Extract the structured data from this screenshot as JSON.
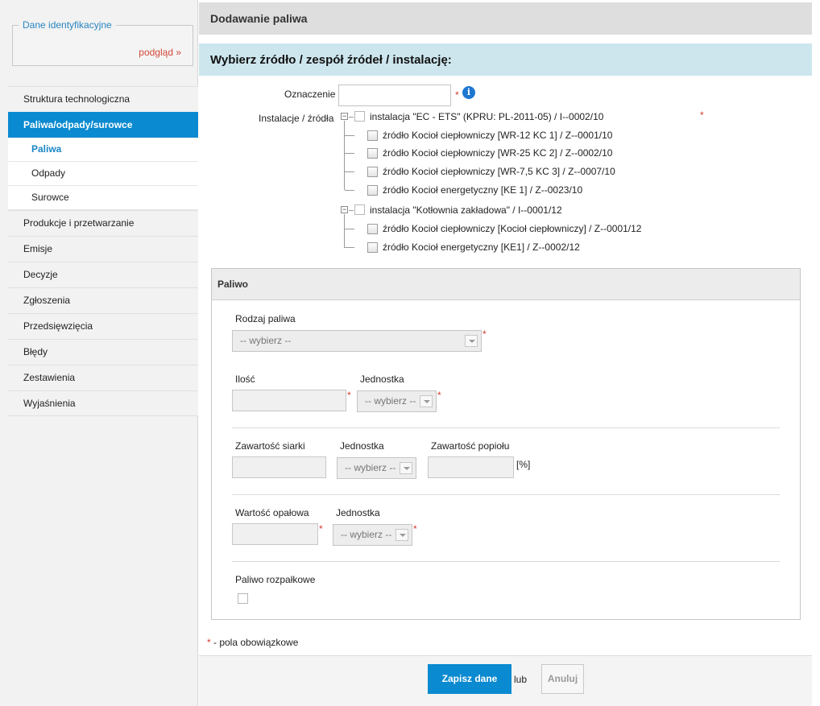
{
  "sidebar": {
    "id_box": {
      "legend": "Dane identyfikacyjne",
      "link": "podgląd »"
    },
    "items": [
      {
        "label": "Struktura technologiczna"
      },
      {
        "label": "Paliwa/odpady/surowce"
      },
      {
        "label": "Produkcje i przetwarzanie"
      },
      {
        "label": "Emisje"
      },
      {
        "label": "Decyzje"
      },
      {
        "label": "Zgłoszenia"
      },
      {
        "label": "Przedsięwzięcia"
      },
      {
        "label": "Błędy"
      },
      {
        "label": "Zestawienia"
      },
      {
        "label": "Wyjaśnienia"
      }
    ],
    "subitems": [
      {
        "label": "Paliwa"
      },
      {
        "label": "Odpady"
      },
      {
        "label": "Surowce"
      }
    ]
  },
  "main": {
    "page_title": "Dodawanie paliwa",
    "section_title": "Wybierz źródło / zespół źródeł / instalację:",
    "oznaczenie_label": "Oznaczenie",
    "oznaczenie_value": "",
    "instalacje_label": "Instalacje / źródła",
    "tree": [
      {
        "label": "instalacja \"EC - ETS\" (KPRU: PL-2011-05) / I--0002/10",
        "children": [
          {
            "label": "źródło Kocioł ciepłowniczy [WR-12 KC 1] / Z--0001/10"
          },
          {
            "label": "źródło Kocioł ciepłowniczy [WR-25 KC 2] / Z--0002/10"
          },
          {
            "label": "źródło Kocioł ciepłowniczy [WR-7,5 KC 3] / Z--0007/10"
          },
          {
            "label": "źródło Kocioł energetyczny [KE 1] / Z--0023/10"
          }
        ]
      },
      {
        "label": "instalacja \"Kotłownia zakładowa\" / I--0001/12",
        "children": [
          {
            "label": "źródło Kocioł ciepłowniczy [Kocioł ciepłowniczy] / Z--0001/12"
          },
          {
            "label": "źródło Kocioł energetyczny [KE1] / Z--0002/12"
          }
        ]
      }
    ]
  },
  "panel": {
    "title": "Paliwo",
    "rodzaj_label": "Rodzaj paliwa",
    "rodzaj_value": "-- wybierz --",
    "ilosc_label": "Ilość",
    "jednostka_label": "Jednostka",
    "select_placeholder": "-- wybierz --",
    "siarka_label": "Zawartość siarki",
    "popiol_label": "Zawartość popiołu",
    "percent": "[%]",
    "opalowa_label": "Wartość opałowa",
    "rozpalkowe_label": "Paliwo rozpałkowe"
  },
  "footer": {
    "req_mark": "*",
    "req_text": " - pola obowiązkowe",
    "save": "Zapisz dane",
    "or": "lub",
    "cancel": "Anuluj"
  },
  "colors": {
    "accent": "#0a8ad0",
    "required": "#d23b2b",
    "section_bg": "#cde6ee"
  }
}
